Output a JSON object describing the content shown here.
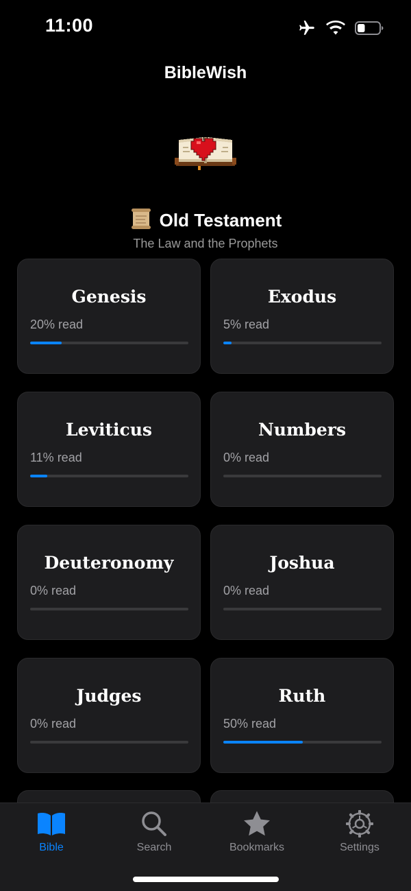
{
  "status": {
    "time": "11:00",
    "battery_level": 0.35
  },
  "nav": {
    "title": "BibleWish"
  },
  "section": {
    "emoji": "📜",
    "title": "Old Testament",
    "subtitle": "The Law and the Prophets"
  },
  "books": [
    {
      "name": "Genesis",
      "progress_label": "20% read",
      "progress": 0.2
    },
    {
      "name": "Exodus",
      "progress_label": "5% read",
      "progress": 0.05
    },
    {
      "name": "Leviticus",
      "progress_label": "11% read",
      "progress": 0.11
    },
    {
      "name": "Numbers",
      "progress_label": "0% read",
      "progress": 0.0
    },
    {
      "name": "Deuteronomy",
      "progress_label": "0% read",
      "progress": 0.0
    },
    {
      "name": "Joshua",
      "progress_label": "0% read",
      "progress": 0.0
    },
    {
      "name": "Judges",
      "progress_label": "0% read",
      "progress": 0.0
    },
    {
      "name": "Ruth",
      "progress_label": "50% read",
      "progress": 0.5
    }
  ],
  "tabs": [
    {
      "label": "Bible",
      "icon": "book-icon",
      "active": true
    },
    {
      "label": "Search",
      "icon": "magnifier-icon",
      "active": false
    },
    {
      "label": "Bookmarks",
      "icon": "star-icon",
      "active": false
    },
    {
      "label": "Settings",
      "icon": "gear-icon",
      "active": false
    }
  ],
  "colors": {
    "accent": "#0a84ff",
    "background": "#000000",
    "card": "#1d1d1f",
    "muted_text": "#9a9a9a"
  }
}
